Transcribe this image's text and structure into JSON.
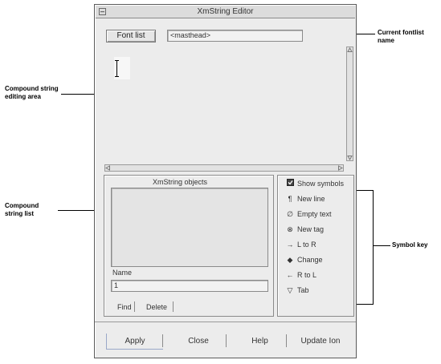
{
  "callouts": {
    "fontlist_name": [
      "Current fontlist",
      "name"
    ],
    "editing_area": [
      "Compound string",
      "editing area"
    ],
    "string_list": [
      "Compound",
      "string list"
    ],
    "symbol_key": "Symbol key"
  },
  "window": {
    "title": "XmString Editor",
    "font_list_button": "Font list",
    "font_list_value": "<masthead>",
    "list_title": "XmString objects",
    "name_label": "Name",
    "name_value": "1",
    "find_button": "Find",
    "delete_button": "Delete",
    "show_symbols": {
      "label": "Show symbols",
      "checked": true
    },
    "symbols": [
      {
        "icon": "¶",
        "icon_name": "newline-symbol-icon",
        "label": "New line"
      },
      {
        "icon": "∅",
        "icon_name": "empty-text-symbol-icon",
        "label": "Empty text"
      },
      {
        "icon": "⊗",
        "icon_name": "new-tag-symbol-icon",
        "label": "New tag"
      },
      {
        "icon": "→",
        "icon_name": "left-to-right-symbol-icon",
        "label": "L to R"
      },
      {
        "icon": "◆",
        "icon_name": "change-symbol-icon",
        "label": "Change"
      },
      {
        "icon": "←",
        "icon_name": "right-to-left-symbol-icon",
        "label": "R to L"
      },
      {
        "icon": "▽",
        "icon_name": "tab-symbol-icon",
        "label": "Tab"
      }
    ],
    "buttons": {
      "apply": "Apply",
      "close": "Close",
      "help": "Help",
      "update": "Update Ion"
    }
  }
}
